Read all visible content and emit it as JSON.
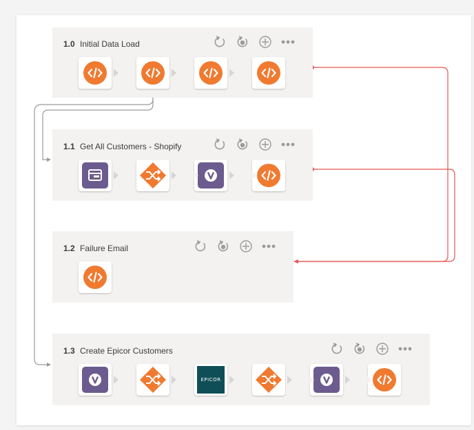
{
  "colors": {
    "orange": "#f07a30",
    "purple": "#6c5b8e",
    "epicor_teal": "#0f4e57",
    "red_wire": "#e8544f",
    "gray_wire": "#9a9a9a"
  },
  "panels": [
    {
      "number": "1.0",
      "title": "Initial Data Load",
      "steps": [
        {
          "icon": "code-icon"
        },
        {
          "icon": "code-icon"
        },
        {
          "icon": "code-icon"
        },
        {
          "icon": "code-icon"
        }
      ]
    },
    {
      "number": "1.1",
      "title": "Get All Customers - Shopify",
      "steps": [
        {
          "icon": "shopify-card-icon"
        },
        {
          "icon": "shuffle-icon"
        },
        {
          "icon": "v-icon"
        },
        {
          "icon": "code-icon"
        }
      ]
    },
    {
      "number": "1.2",
      "title": "Failure Email",
      "steps": [
        {
          "icon": "code-icon"
        }
      ]
    },
    {
      "number": "1.3",
      "title": "Create Epicor Customers",
      "steps": [
        {
          "icon": "v-icon"
        },
        {
          "icon": "shuffle-icon"
        },
        {
          "icon": "epicor-logo",
          "text": "EPICOR"
        },
        {
          "icon": "shuffle-icon"
        },
        {
          "icon": "v-icon"
        },
        {
          "icon": "code-icon"
        }
      ]
    }
  ],
  "toolbar_icons": [
    "refresh-icon",
    "reset-icon",
    "add-icon",
    "more-icon"
  ]
}
